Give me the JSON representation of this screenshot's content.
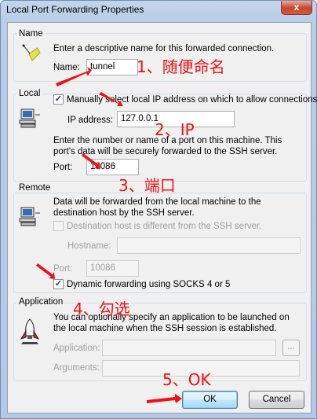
{
  "window": {
    "title": "Local Port Forwarding Properties",
    "close_label": "x"
  },
  "name_group": {
    "label": "Name",
    "description": "Enter a descriptive name for this forwarded connection.",
    "field_label": "Name:",
    "field_value": "tunnel"
  },
  "local_group": {
    "label": "Local",
    "manual_checkbox_label": "Manually select local IP address on which to allow connections.",
    "manual_checked": true,
    "ip_label": "IP address:",
    "ip_value": "127.0.0.1",
    "port_description": "Enter the number or name of a port on this machine.  This port's data will be securely forwarded to the SSH server.",
    "port_label": "Port:",
    "port_value": "10086"
  },
  "remote_group": {
    "label": "Remote",
    "description": "Data will be forwarded from the local machine to the destination host by the SSH server.",
    "dest_checkbox_label": "Destination host is different from the SSH server.",
    "dest_checked": false,
    "hostname_label": "Hostname:",
    "hostname_value": "",
    "port_label": "Port:",
    "port_value": "10086",
    "dynamic_checkbox_label": "Dynamic forwarding using SOCKS 4 or 5",
    "dynamic_checked": true
  },
  "application_group": {
    "label": "Application",
    "description": "You can optionally specify an application to be launched on the local machine when the SSH session is established.",
    "application_label": "Application:",
    "application_value": "",
    "browse_label": "...",
    "arguments_label": "Arguments:",
    "arguments_value": ""
  },
  "buttons": {
    "ok": "OK",
    "cancel": "Cancel"
  },
  "annotations": {
    "step1": "1、随便命名",
    "step2": "2、IP",
    "step3": "3、端口",
    "step4": "4、勾选",
    "step5": "5、OK",
    "color": "#ee1111"
  },
  "icons": {
    "name": "name-tag-icon",
    "local": "computer-icon",
    "remote": "computer-icon",
    "application": "rocket-icon"
  }
}
